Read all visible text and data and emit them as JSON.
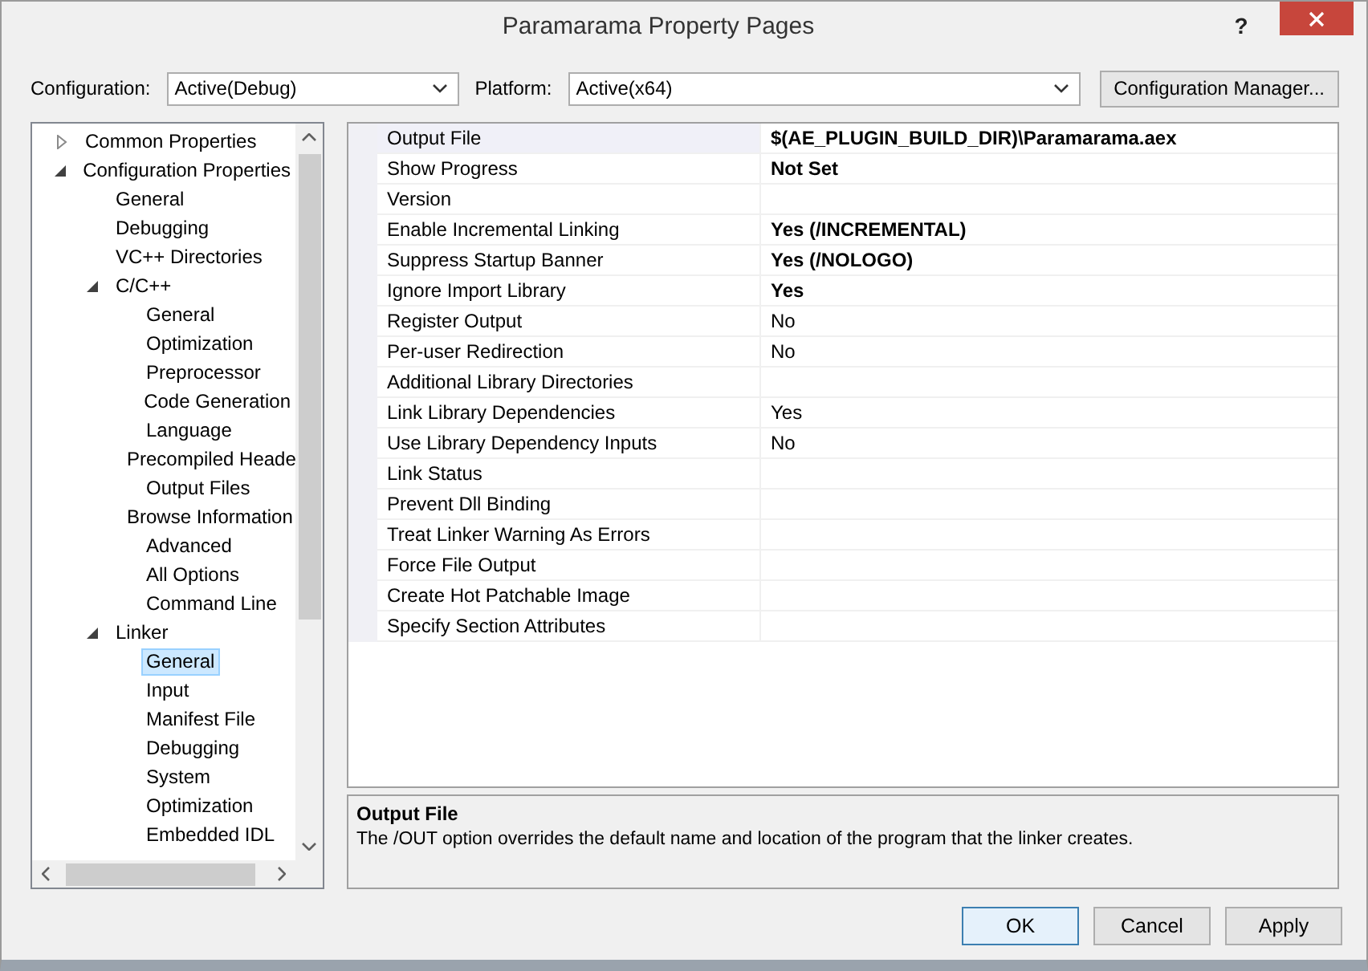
{
  "window": {
    "title": "Paramarama Property Pages",
    "help": "?"
  },
  "config_bar": {
    "configuration": {
      "label": "Configuration:",
      "value": "Active(Debug)"
    },
    "platform": {
      "label": "Platform:",
      "value": "Active(x64)"
    },
    "manager_button": "Configuration Manager..."
  },
  "tree": [
    {
      "label": "Common Properties",
      "expanded": false,
      "selected": false
    },
    {
      "label": "Configuration Properties",
      "expanded": true,
      "selected": false,
      "children": [
        {
          "label": "General",
          "selected": false
        },
        {
          "label": "Debugging",
          "selected": false
        },
        {
          "label": "VC++ Directories",
          "selected": false
        },
        {
          "label": "C/C++",
          "expanded": true,
          "selected": false,
          "children": [
            {
              "label": "General",
              "selected": false
            },
            {
              "label": "Optimization",
              "selected": false
            },
            {
              "label": "Preprocessor",
              "selected": false
            },
            {
              "label": "Code Generation",
              "selected": false
            },
            {
              "label": "Language",
              "selected": false
            },
            {
              "label": "Precompiled Heade",
              "selected": false
            },
            {
              "label": "Output Files",
              "selected": false
            },
            {
              "label": "Browse Information",
              "selected": false
            },
            {
              "label": "Advanced",
              "selected": false
            },
            {
              "label": "All Options",
              "selected": false
            },
            {
              "label": "Command Line",
              "selected": false
            }
          ]
        },
        {
          "label": "Linker",
          "expanded": true,
          "selected": false,
          "children": [
            {
              "label": "General",
              "selected": true
            },
            {
              "label": "Input",
              "selected": false
            },
            {
              "label": "Manifest File",
              "selected": false
            },
            {
              "label": "Debugging",
              "selected": false
            },
            {
              "label": "System",
              "selected": false
            },
            {
              "label": "Optimization",
              "selected": false
            },
            {
              "label": "Embedded IDL",
              "selected": false
            }
          ]
        }
      ]
    }
  ],
  "properties": [
    {
      "name": "Output File",
      "value": "$(AE_PLUGIN_BUILD_DIR)\\Paramarama.aex",
      "modified": true,
      "selected": true
    },
    {
      "name": "Show Progress",
      "value": "Not Set",
      "modified": true,
      "selected": false
    },
    {
      "name": "Version",
      "selected": false
    },
    {
      "name": "Enable Incremental Linking",
      "value": "Yes (/INCREMENTAL)",
      "modified": true,
      "selected": false
    },
    {
      "name": "Suppress Startup Banner",
      "value": "Yes (/NOLOGO)",
      "modified": true,
      "selected": false
    },
    {
      "name": "Ignore Import Library",
      "value": "Yes",
      "modified": true,
      "selected": false
    },
    {
      "name": "Register Output",
      "value": "No",
      "modified": false,
      "selected": false
    },
    {
      "name": "Per-user Redirection",
      "value": "No",
      "modified": false,
      "selected": false
    },
    {
      "name": "Additional Library Directories",
      "selected": false
    },
    {
      "name": "Link Library Dependencies",
      "value": "Yes",
      "modified": false,
      "selected": false
    },
    {
      "name": "Use Library Dependency Inputs",
      "value": "No",
      "modified": false,
      "selected": false
    },
    {
      "name": "Link Status",
      "selected": false
    },
    {
      "name": "Prevent Dll Binding",
      "selected": false
    },
    {
      "name": "Treat Linker Warning As Errors",
      "selected": false
    },
    {
      "name": "Force File Output",
      "selected": false
    },
    {
      "name": "Create Hot Patchable Image",
      "selected": false
    },
    {
      "name": "Specify Section Attributes",
      "selected": false
    }
  ],
  "description": {
    "title": "Output File",
    "text": "The /OUT option overrides the default name and location of the program that the linker creates."
  },
  "buttons": [
    {
      "label": "OK",
      "default": true
    },
    {
      "label": "Cancel",
      "default": false
    },
    {
      "label": "Apply",
      "default": false
    }
  ]
}
